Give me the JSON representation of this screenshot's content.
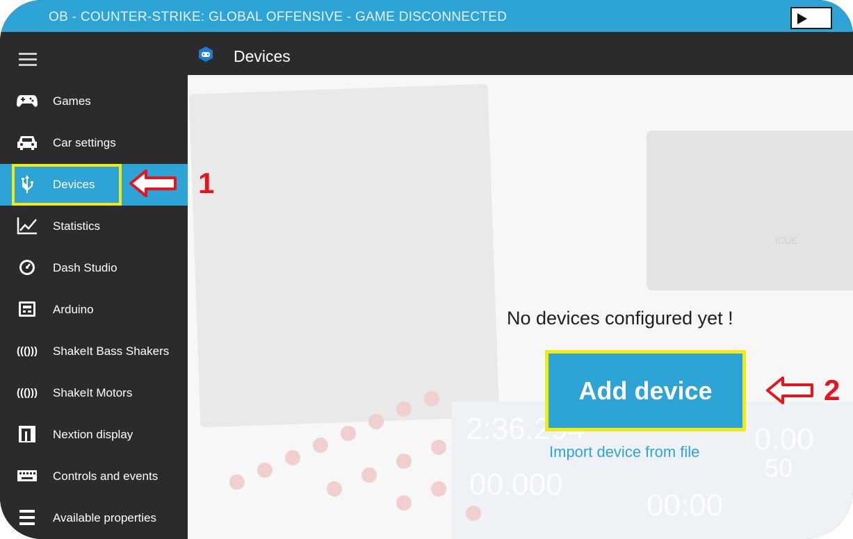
{
  "window": {
    "title": "OB - COUNTER-STRIKE: GLOBAL OFFENSIVE - GAME DISCONNECTED"
  },
  "header": {
    "page_title": "Devices",
    "menu_icon": "hamburger-menu-icon",
    "app_icon": "gamepad-hex-icon"
  },
  "sidebar": {
    "items": [
      {
        "label": "Games",
        "icon": "gamepad-icon",
        "active": false
      },
      {
        "label": "Car settings",
        "icon": "car-icon",
        "active": false
      },
      {
        "label": "Devices",
        "icon": "usb-icon",
        "active": true
      },
      {
        "label": "Statistics",
        "icon": "line-chart-icon",
        "active": false
      },
      {
        "label": "Dash Studio",
        "icon": "gauge-icon",
        "active": false
      },
      {
        "label": "Arduino",
        "icon": "circuit-board-icon",
        "active": false
      },
      {
        "label": "ShakeIt Bass Shakers",
        "icon": "vibration-icon",
        "active": false
      },
      {
        "label": "ShakeIt Motors",
        "icon": "vibration-icon",
        "active": false
      },
      {
        "label": "Nextion display",
        "icon": "nextion-icon",
        "active": false
      },
      {
        "label": "Controls and events",
        "icon": "keyboard-icon",
        "active": false
      },
      {
        "label": "Available properties",
        "icon": "properties-icon",
        "active": false
      }
    ]
  },
  "main": {
    "empty_message": "No devices configured yet !",
    "add_button_label": "Add device",
    "import_link_label": "Import device from file"
  },
  "annotations": {
    "step1": "1",
    "step2": "2"
  },
  "background_text": {
    "t1": "2:36.294",
    "t2": "0.00",
    "t3": "00.000",
    "t4": "00:00",
    "t5": "50",
    "t6": "iCUE"
  },
  "colors": {
    "accent": "#2ea3d6",
    "sidebar_bg": "#2b2b2b",
    "highlight_box": "#f4ea13",
    "annotation_red": "#e8141c"
  }
}
